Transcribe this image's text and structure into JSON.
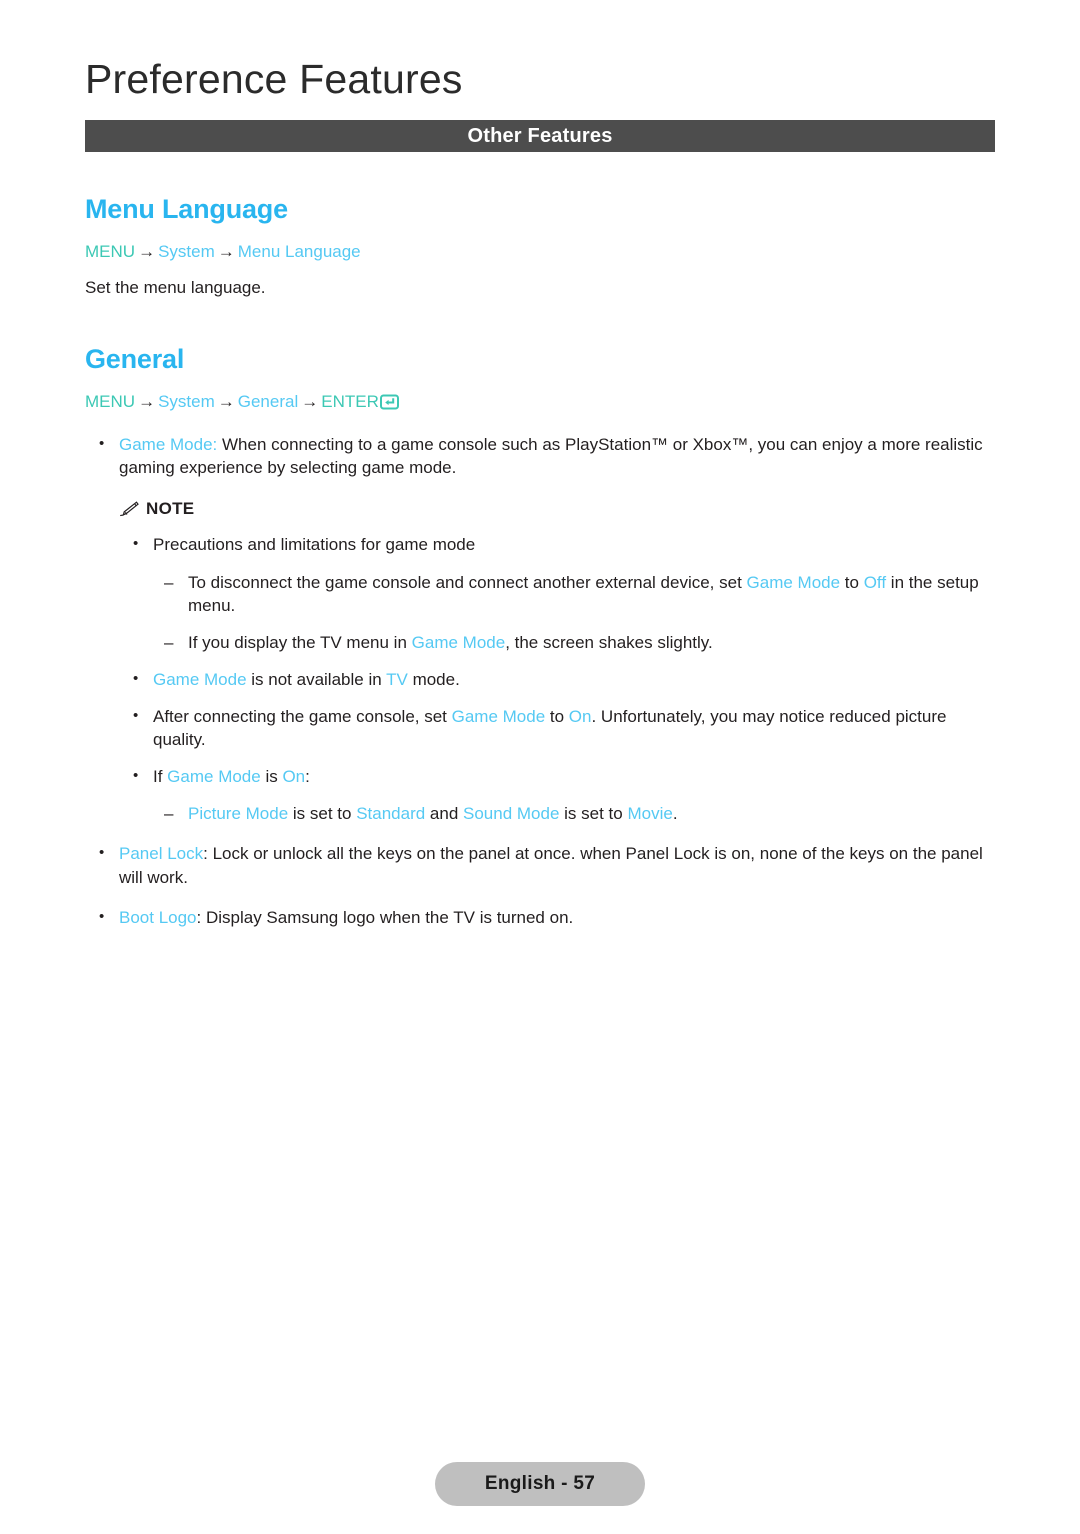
{
  "header": {
    "title": "Preference Features",
    "section_bar_label": "Other Features",
    "bar_color": "#4d4d4d",
    "accent_blue": "#29b5ef",
    "term_blue": "#55c9f3",
    "menu_green": "#3cc8b4"
  },
  "menu_language": {
    "heading": "Menu Language",
    "path": {
      "menu": "MENU",
      "arrow": "→",
      "step1": "System",
      "step2": "Menu Language"
    },
    "description": "Set the menu language."
  },
  "general": {
    "heading": "General",
    "path": {
      "menu": "MENU",
      "arrow": "→",
      "step1": "System",
      "step2": "General",
      "enter": "ENTER",
      "enter_icon": "enter-key-icon"
    },
    "game_mode": {
      "term": "Game Mode:",
      "text_a": " When connecting to a game console such as PlayStation™ or Xbox™, you can enjoy a more realistic gaming experience by selecting game mode."
    },
    "note": {
      "icon": "pencil-icon",
      "label": "NOTE",
      "items": [
        {
          "level": 2,
          "marker": "dot",
          "parts": [
            {
              "text": "Precautions and limitations for game mode",
              "style": "plain"
            }
          ]
        },
        {
          "level": 3,
          "marker": "dash",
          "parts": [
            {
              "text": "To disconnect the game console and connect another external device, set ",
              "style": "plain"
            },
            {
              "text": "Game Mode",
              "style": "term"
            },
            {
              "text": " to ",
              "style": "plain"
            },
            {
              "text": "Off",
              "style": "term"
            },
            {
              "text": " in the setup menu.",
              "style": "plain"
            }
          ]
        },
        {
          "level": 3,
          "marker": "dash",
          "parts": [
            {
              "text": "If you display the TV menu in ",
              "style": "plain"
            },
            {
              "text": "Game Mode",
              "style": "term"
            },
            {
              "text": ", the screen shakes slightly.",
              "style": "plain"
            }
          ]
        },
        {
          "level": 2,
          "marker": "dot",
          "parts": [
            {
              "text": "Game Mode",
              "style": "term"
            },
            {
              "text": " is not available in ",
              "style": "plain"
            },
            {
              "text": "TV",
              "style": "term"
            },
            {
              "text": " mode.",
              "style": "plain"
            }
          ]
        },
        {
          "level": 2,
          "marker": "dot",
          "parts": [
            {
              "text": "After connecting the game console, set ",
              "style": "plain"
            },
            {
              "text": "Game Mode",
              "style": "term"
            },
            {
              "text": " to ",
              "style": "plain"
            },
            {
              "text": "On",
              "style": "term"
            },
            {
              "text": ". Unfortunately, you may notice reduced picture quality.",
              "style": "plain"
            }
          ]
        },
        {
          "level": 2,
          "marker": "dot",
          "parts": [
            {
              "text": "If ",
              "style": "plain"
            },
            {
              "text": "Game Mode",
              "style": "term"
            },
            {
              "text": " is ",
              "style": "plain"
            },
            {
              "text": "On",
              "style": "term"
            },
            {
              "text": ":",
              "style": "plain"
            }
          ]
        },
        {
          "level": 4,
          "marker": "dash",
          "parts": [
            {
              "text": "Picture Mode",
              "style": "term"
            },
            {
              "text": " is set to ",
              "style": "plain"
            },
            {
              "text": "Standard",
              "style": "term"
            },
            {
              "text": " and ",
              "style": "plain"
            },
            {
              "text": "Sound Mode",
              "style": "term"
            },
            {
              "text": " is set to ",
              "style": "plain"
            },
            {
              "text": "Movie",
              "style": "term"
            },
            {
              "text": ".",
              "style": "plain"
            }
          ]
        }
      ]
    },
    "bullets_after_note": [
      {
        "level": 1,
        "marker": "dot",
        "parts": [
          {
            "text": "Panel Lock",
            "style": "term"
          },
          {
            "text": ": Lock or unlock all the keys on the panel at once. when Panel Lock is on, none of the keys on the panel will work.",
            "style": "plain"
          }
        ]
      },
      {
        "level": 1,
        "marker": "dot",
        "parts": [
          {
            "text": "Boot Logo",
            "style": "term"
          },
          {
            "text": ": Display Samsung logo when the TV is turned on.",
            "style": "plain"
          }
        ]
      }
    ]
  },
  "footer": {
    "page_label": "English - 57"
  }
}
